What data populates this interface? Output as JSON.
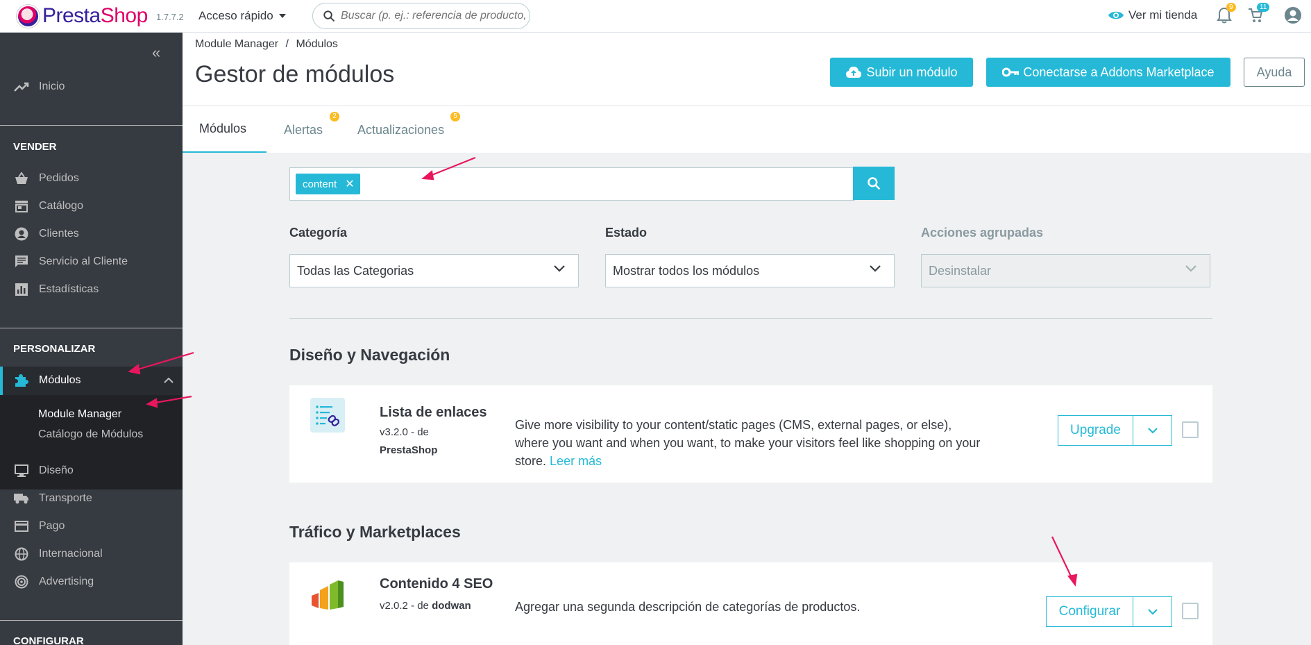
{
  "topbar": {
    "brand_part1": "Presta",
    "brand_part2": "Shop",
    "version": "1.7.7.2",
    "quick_access": "Acceso rápido",
    "search_placeholder": "Buscar (p. ej.: referencia de producto, no",
    "view_store": "Ver mi tienda",
    "notifications_count": "9",
    "orders_count": "11",
    "colors": {
      "accent": "#25b9d7",
      "badge_orange": "#fbbb22"
    }
  },
  "sidebar": {
    "inicio": "Inicio",
    "section_sell": "VENDER",
    "sell_items": [
      "Pedidos",
      "Catálogo",
      "Clientes",
      "Servicio al Cliente",
      "Estadísticas"
    ],
    "section_customize": "PERSONALIZAR",
    "modules": "Módulos",
    "modules_sub": [
      "Module Manager",
      "Catálogo de Módulos"
    ],
    "customize_items": [
      "Diseño",
      "Transporte",
      "Pago",
      "Internacional",
      "Advertising"
    ],
    "section_configure": "CONFIGURAR"
  },
  "header": {
    "breadcrumb_1": "Module Manager",
    "breadcrumb_sep": "/",
    "breadcrumb_2": "Módulos",
    "title": "Gestor de módulos",
    "upload_btn": "Subir un módulo",
    "addons_btn": "Conectarse a Addons Marketplace",
    "help_btn": "Ayuda"
  },
  "tabs": {
    "modules": "Módulos",
    "alerts": "Alertas",
    "alerts_count": "2",
    "updates": "Actualizaciones",
    "updates_count": "5"
  },
  "filters": {
    "search_tag": "content",
    "category_label": "Categoría",
    "category_value": "Todas las Categorias",
    "status_label": "Estado",
    "status_value": "Mostrar todos los módulos",
    "bulk_label": "Acciones agrupadas",
    "bulk_value": "Desinstalar"
  },
  "sections": [
    {
      "title": "Diseño y Navegación",
      "module": {
        "name": "Lista de enlaces",
        "version": "v3.2.0 - de",
        "author": "PrestaShop",
        "description": "Give more visibility to your content/static pages (CMS, external pages, or else), where you want and when you want, to make your visitors feel like shopping on your store.",
        "read_more": "Leer más",
        "action": "Upgrade"
      }
    },
    {
      "title": "Tráfico y Marketplaces",
      "module": {
        "name": "Contenido 4 SEO",
        "version": "v2.0.2 - de",
        "author": "dodwan",
        "description": "Agregar una segunda descripción de categorías de productos.",
        "action": "Configurar"
      }
    }
  ]
}
